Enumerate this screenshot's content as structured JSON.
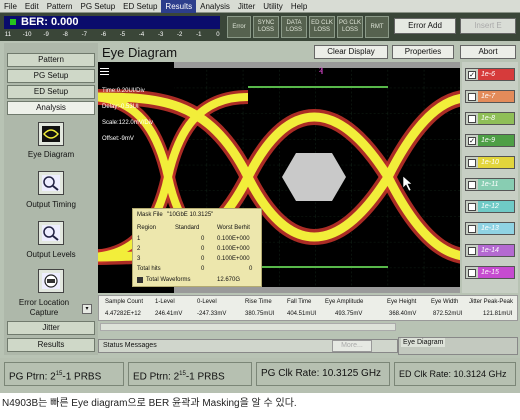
{
  "menu": [
    "File",
    "Edit",
    "Pattern",
    "PG Setup",
    "ED Setup",
    "Results",
    "Analysis",
    "Jitter",
    "Utility",
    "Help"
  ],
  "ber": {
    "label": "BER: 0.000",
    "scale": [
      "11",
      "-10",
      "-9",
      "-8",
      "-7",
      "-6",
      "-5",
      "-4",
      "-3",
      "-2",
      "-1",
      "0"
    ]
  },
  "indicators": [
    "Error",
    "SYNC LOSS",
    "DATA LOSS",
    "ED CLK LOSS",
    "PG CLK LOSS",
    "RMT"
  ],
  "toolbar": {
    "error_add": "Error Add",
    "insert": "Insert E"
  },
  "nav": {
    "pattern": "Pattern",
    "pg_setup": "PG Setup",
    "ed_setup": "ED Setup",
    "analysis": "Analysis",
    "eye_diagram": "Eye Diagram",
    "output_timing": "Output Timing",
    "output_levels": "Output Levels",
    "error_location_capture": "Error Location Capture",
    "jitter": "Jitter",
    "results": "Results"
  },
  "pane": {
    "title": "Eye Diagram",
    "clear_display": "Clear Display",
    "properties": "Properties",
    "abort": "Abort"
  },
  "plot": {
    "time": "Time:0.20UI/Div",
    "delay": "Delay:-0.53UI",
    "scale": "Scale:122.0mV/Div",
    "offset": "Offset:-9mV",
    "marker": "2"
  },
  "mask": {
    "file_label": "Mask File",
    "file_value": "\"10GbE 10.3125\"",
    "headers": [
      "Region",
      "Standard",
      "Worst Berhit"
    ],
    "rows": [
      [
        "1",
        "0",
        "0.100E+000"
      ],
      [
        "2",
        "0",
        "0.100E+000"
      ],
      [
        "3",
        "0",
        "0.100E+000"
      ]
    ],
    "total_hits_label": "Total hits",
    "total_hits_a": "0",
    "total_hits_b": "0",
    "waveforms_label": "Total Waveforms",
    "waveforms_value": "12.670G"
  },
  "channels": [
    {
      "label": "1e-6",
      "checked": true,
      "color": "#d63b3b"
    },
    {
      "label": "1e-7",
      "checked": false,
      "color": "#e38b5a"
    },
    {
      "label": "1e-8",
      "checked": false,
      "color": "#8fbf58"
    },
    {
      "label": "1e-9",
      "checked": true,
      "color": "#4e9f46"
    },
    {
      "label": "1e-10",
      "checked": false,
      "color": "#e2d53c"
    },
    {
      "label": "1e-11",
      "checked": false,
      "color": "#88cdb2"
    },
    {
      "label": "1e-12",
      "checked": false,
      "color": "#6fcac6"
    },
    {
      "label": "1e-13",
      "checked": false,
      "color": "#8fd3e3"
    },
    {
      "label": "1e-14",
      "checked": false,
      "color": "#b46ad1"
    },
    {
      "label": "1e-15",
      "checked": false,
      "color": "#c64bd0"
    }
  ],
  "measurements": {
    "headers": [
      "Sample Count",
      "1-Level",
      "0-Level",
      "Rise Time",
      "Fall Time",
      "Eye Amplitude",
      "Eye Height",
      "Eye Width",
      "Jitter Peak-Peak"
    ],
    "values": [
      "4.47282E+12",
      "246.41mV",
      "-247.33mV",
      "380.75mUI",
      "404.51mUI",
      "493.75mV",
      "368.40mV",
      "872.52mUI",
      "121.81mUI"
    ]
  },
  "status": {
    "label": "Status Messages",
    "more": "More...",
    "tab": "Eye Diagram"
  },
  "statusbar": {
    "pg_ptrn": "PG Ptrn: 2",
    "ed_ptrn": "ED Ptrn: 2",
    "exp": "15",
    "suffix": "-1 PRBS",
    "pg_clk": "PG Clk Rate: 10.3125 GHz",
    "ed_clk": "ED Clk Rate: 10.3124 GHz"
  },
  "caption": "N4903B는 빠른 Eye diagram으로 BER 윤곽과 Masking을 알 수 있다.",
  "colors": {
    "plot_bg": "#000000",
    "eye_yellow": "#f2ee3a",
    "eye_red": "#d6392f",
    "mask_gray": "#c9c9c9",
    "ber_bar": "#0a0c6c",
    "accent": "#2c3e8c"
  }
}
